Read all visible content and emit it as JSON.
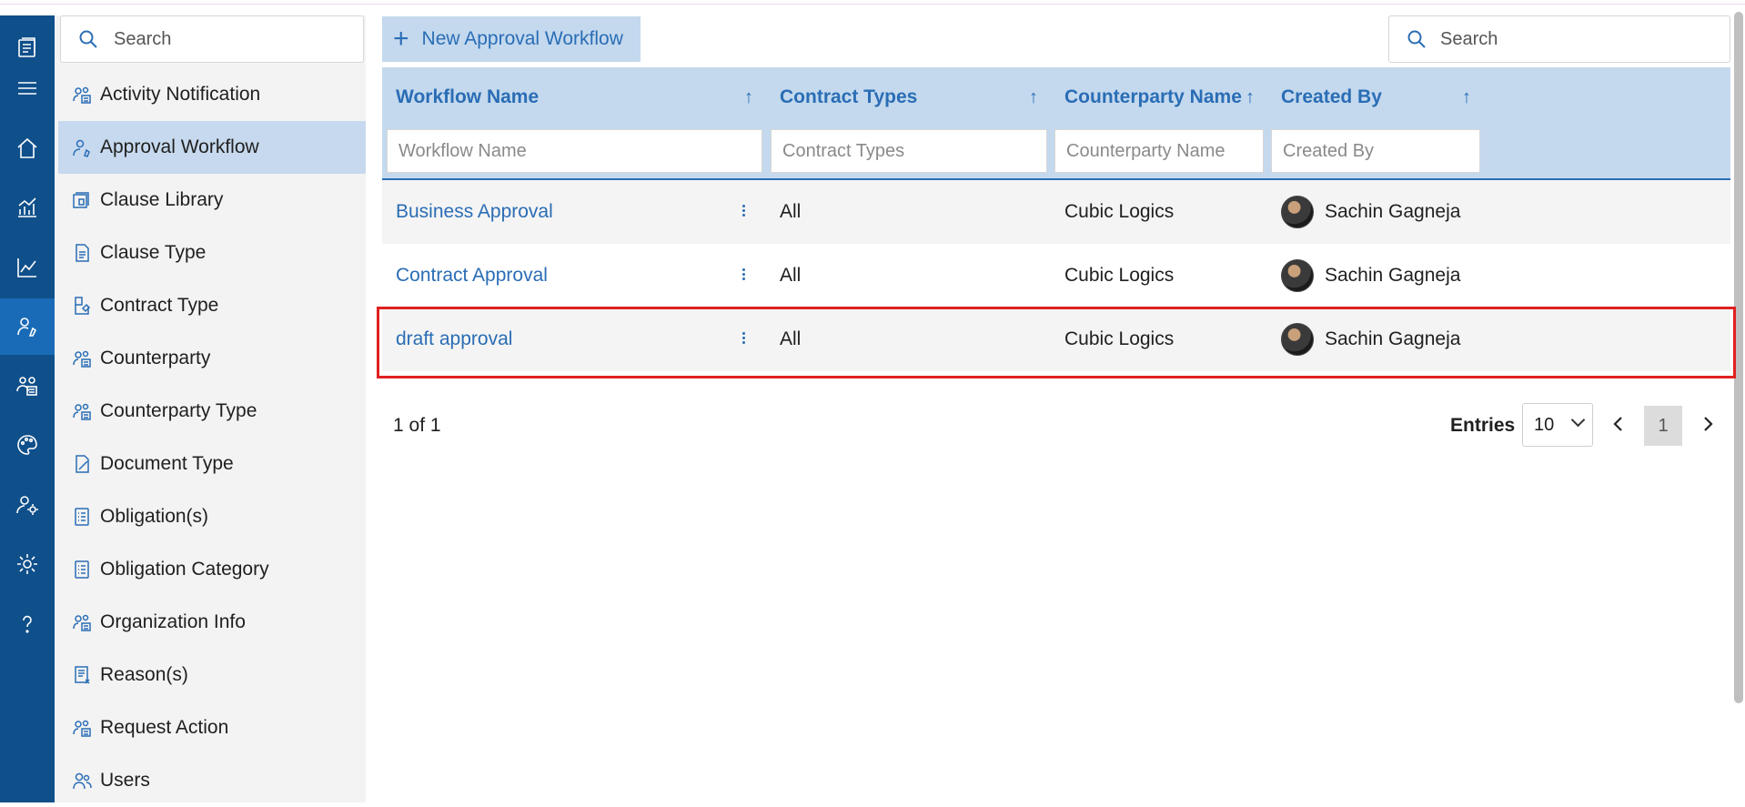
{
  "sidebar": {
    "search_placeholder": "Search",
    "items": [
      {
        "label": "Activity Notification",
        "icon": "people-icon",
        "active": false
      },
      {
        "label": "Approval Workflow",
        "icon": "user-flow-icon",
        "active": true
      },
      {
        "label": "Clause Library",
        "icon": "library-icon",
        "active": false
      },
      {
        "label": "Clause Type",
        "icon": "document-icon",
        "active": false
      },
      {
        "label": "Contract Type",
        "icon": "contract-icon",
        "active": false
      },
      {
        "label": "Counterparty",
        "icon": "people-icon",
        "active": false
      },
      {
        "label": "Counterparty Type",
        "icon": "people-icon",
        "active": false
      },
      {
        "label": "Document Type",
        "icon": "document-type-icon",
        "active": false
      },
      {
        "label": "Obligation(s)",
        "icon": "list-icon",
        "active": false
      },
      {
        "label": "Obligation Category",
        "icon": "list-icon",
        "active": false
      },
      {
        "label": "Organization Info",
        "icon": "people-icon",
        "active": false
      },
      {
        "label": "Reason(s)",
        "icon": "reason-icon",
        "active": false
      },
      {
        "label": "Request Action",
        "icon": "people-icon",
        "active": false
      },
      {
        "label": "Users",
        "icon": "users-icon",
        "active": false
      }
    ]
  },
  "toolbar": {
    "new_button_label": "New Approval Workflow",
    "search_placeholder": "Search"
  },
  "table": {
    "columns": [
      {
        "label": "Workflow Name",
        "filter_placeholder": "Workflow Name"
      },
      {
        "label": "Contract Types",
        "filter_placeholder": "Contract Types"
      },
      {
        "label": "Counterparty Name",
        "filter_placeholder": "Counterparty Name"
      },
      {
        "label": "Created By",
        "filter_placeholder": "Created By"
      }
    ],
    "rows": [
      {
        "workflow_name": "Business Approval",
        "contract_types": "All",
        "counterparty_name": "Cubic Logics",
        "created_by": "Sachin Gagneja"
      },
      {
        "workflow_name": "Contract Approval",
        "contract_types": "All",
        "counterparty_name": "Cubic Logics",
        "created_by": "Sachin Gagneja"
      },
      {
        "workflow_name": "draft approval",
        "contract_types": "All",
        "counterparty_name": "Cubic Logics",
        "created_by": "Sachin Gagneja"
      }
    ]
  },
  "pagination": {
    "page_count_text": "1 of 1",
    "entries_label": "Entries",
    "entries_value": "10",
    "current_page": "1"
  },
  "colors": {
    "rail_bg": "#0f4f8a",
    "accent": "#2a6db5",
    "header_bg": "#c4d9ee",
    "highlight_border": "#e02020"
  }
}
